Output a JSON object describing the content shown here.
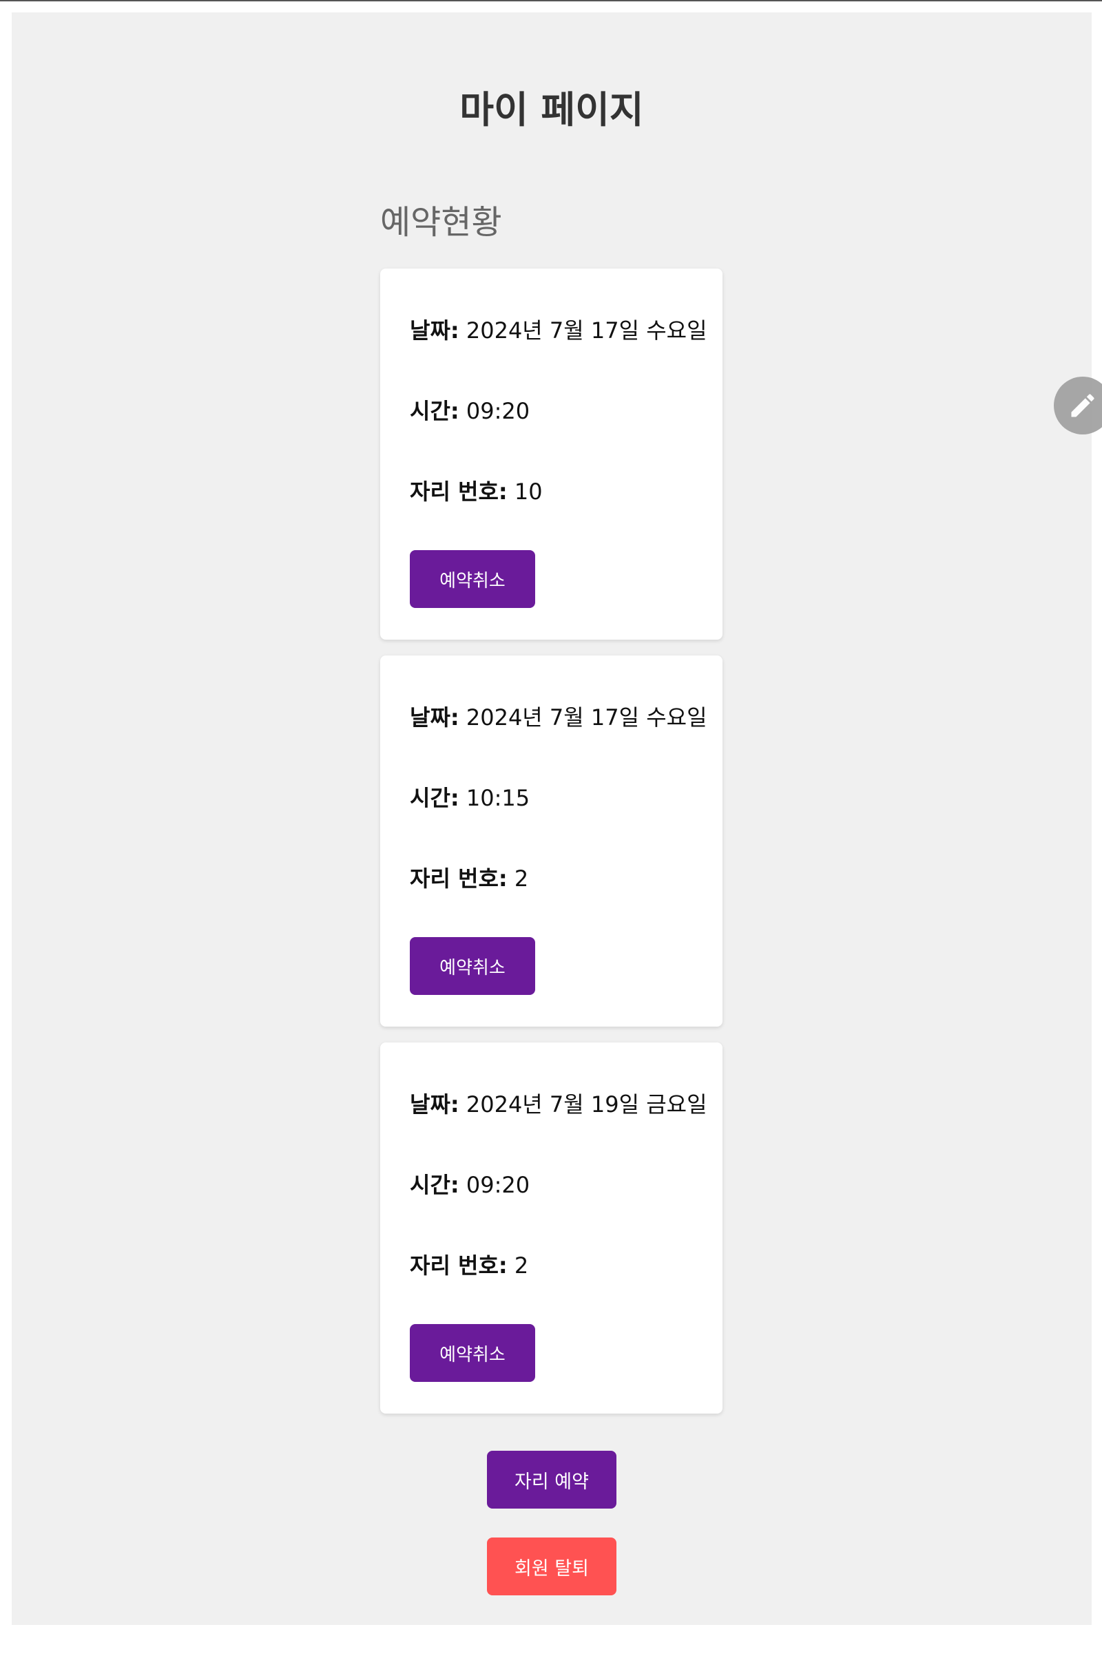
{
  "page": {
    "title": "마이 페이지",
    "section_title": "예약현황"
  },
  "reservations": [
    {
      "date_label": "날짜:",
      "date_value": " 2024년 7월 17일 수요일",
      "time_label": "시간:",
      "time_value": " 09:20",
      "seat_label": "자리 번호:",
      "seat_value": " 10",
      "cancel_label": "예약취소"
    },
    {
      "date_label": "날짜:",
      "date_value": " 2024년 7월 17일 수요일",
      "time_label": "시간:",
      "time_value": " 10:15",
      "seat_label": "자리 번호:",
      "seat_value": " 2",
      "cancel_label": "예약취소"
    },
    {
      "date_label": "날짜:",
      "date_value": " 2024년 7월 19일 금요일",
      "time_label": "시간:",
      "time_value": " 09:20",
      "seat_label": "자리 번호:",
      "seat_value": " 2",
      "cancel_label": "예약취소"
    }
  ],
  "actions": {
    "reserve_label": "자리 예약",
    "withdraw_label": "회원 탈퇴"
  },
  "icons": {
    "fab": "pencil-icon"
  },
  "colors": {
    "primary": "#6a1b9a",
    "danger": "#ff5252",
    "background": "#f0f0f0",
    "card": "#ffffff",
    "fab": "#9e9e9e"
  }
}
